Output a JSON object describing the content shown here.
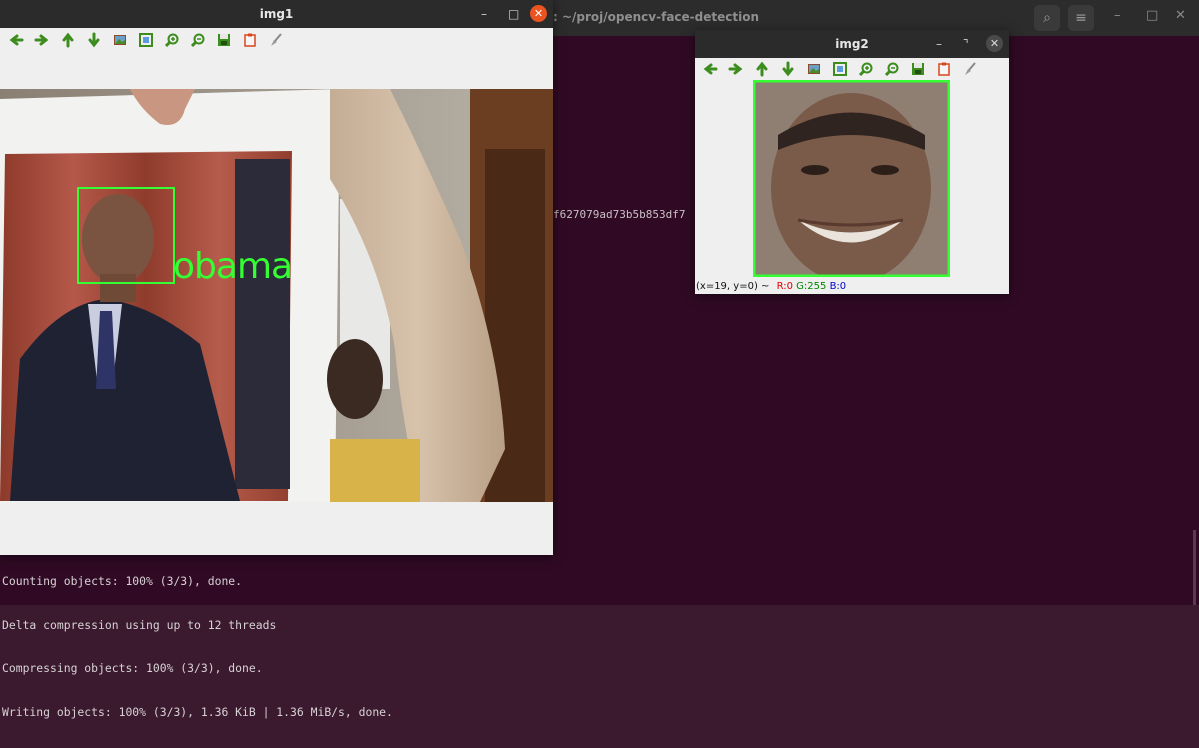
{
  "terminal": {
    "title": ": ~/proj/opencv-face-detection",
    "hash_fragment": "f627079ad73b5b853df7",
    "lines": [
      "Counting objects: 100% (3/3), done.",
      "Delta compression using up to 12 threads",
      "Compressing objects: 100% (3/3), done.",
      "Writing objects: 100% (3/3), 1.36 KiB | 1.36 MiB/s, done."
    ],
    "controls": {
      "search": "⌕",
      "menu": "≡",
      "minimize": "–",
      "maximize": "□",
      "close": "✕"
    }
  },
  "img1": {
    "title": "img1",
    "face_label": "obama",
    "controls": {
      "minimize": "–",
      "maximize": "□",
      "close": "✕"
    }
  },
  "img2": {
    "title": "img2",
    "status": {
      "coords": "(x=19, y=0) ~",
      "r": "R:0",
      "g": "G:255",
      "b": "B:0"
    },
    "controls": {
      "minimize": "–",
      "maximize": "⌝",
      "close": "✕"
    }
  },
  "toolbar_icons": [
    "arrow-left-icon",
    "arrow-right-icon",
    "arrow-up-icon",
    "arrow-down-icon",
    "image-icon",
    "fit-window-icon",
    "zoom-in-icon",
    "zoom-out-icon",
    "save-icon",
    "properties-icon",
    "brush-icon"
  ],
  "colors": {
    "terminal_bg": "#300a24",
    "detection_box": "#33ff33",
    "close_accent": "#e95420",
    "toolbar_green": "#3c8c1e"
  }
}
